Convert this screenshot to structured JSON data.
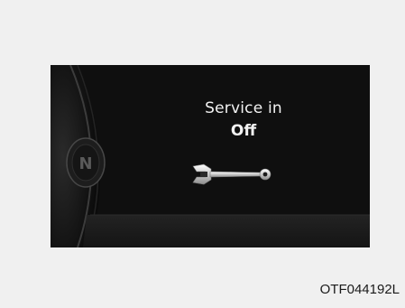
{
  "display": {
    "title_line": "Service in",
    "status_value": "Off",
    "gear_indicator": "N",
    "icon": "wrench-icon"
  },
  "figure": {
    "code": "OTF044192L"
  },
  "colors": {
    "page_background": "#f0f0f0",
    "cluster_background": "#101010",
    "text": "#f2f2f2"
  }
}
